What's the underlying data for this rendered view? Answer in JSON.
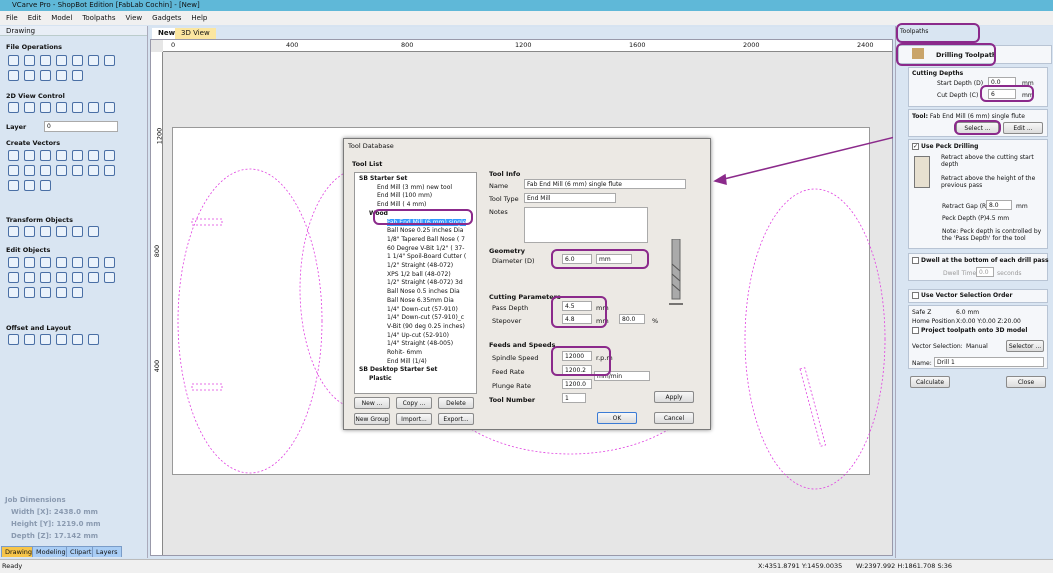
{
  "app": {
    "title": "VCarve Pro - ShopBot Edition [FabLab Cochin] - [New]",
    "menu": [
      "File",
      "Edit",
      "Model",
      "Toolpaths",
      "View",
      "Gadgets",
      "Help"
    ]
  },
  "left_panel": {
    "header": "Drawing",
    "sections": {
      "file_ops": "File Operations",
      "view_control": "2D View Control",
      "layer_label": "Layer",
      "layer_value": "0",
      "create_vectors": "Create Vectors",
      "transform": "Transform Objects",
      "edit_objects": "Edit Objects",
      "offset_layout": "Offset and Layout"
    },
    "job": {
      "title": "Job Dimensions",
      "width": "Width  [X]: 2438.0 mm",
      "height": "Height [Y]: 1219.0 mm",
      "depth": "Depth  [Z]: 17.142 mm"
    },
    "bottom_tabs": [
      "Drawing",
      "Modeling",
      "Clipart",
      "Layers"
    ]
  },
  "view_tabs": [
    "New",
    "3D View"
  ],
  "ruler": {
    "h": [
      "0",
      "400",
      "800",
      "1200",
      "1600",
      "2000",
      "2400"
    ],
    "v": [
      "1200",
      "800",
      "400"
    ]
  },
  "dialog": {
    "title": "Tool Database",
    "tool_list_label": "Tool List",
    "tree": [
      {
        "label": "SB Starter Set",
        "level": 0,
        "group": true
      },
      {
        "label": "End Mill (3 mm) new tool",
        "level": 1
      },
      {
        "label": "End Mill (100 mm)",
        "level": 1
      },
      {
        "label": "End Mill ( 4 mm)",
        "level": 1
      },
      {
        "label": "Wood",
        "level": 1,
        "group": true
      },
      {
        "label": "Fab End Mill (6 mm) single",
        "level": 2,
        "selected": true
      },
      {
        "label": "Ball Nose 0.25 inches Dia",
        "level": 2
      },
      {
        "label": "1/8\" Tapered Ball Nose ( 7",
        "level": 2
      },
      {
        "label": "60 Degree V-Bit 1/2\"  ( 37-",
        "level": 2
      },
      {
        "label": "1 1/4\" Spoil-Board Cutter (",
        "level": 2
      },
      {
        "label": "1/2\" Straight  (48-072)",
        "level": 2
      },
      {
        "label": "XPS 1/2 ball  (48-072)",
        "level": 2
      },
      {
        "label": "1/2\" Straight  (48-072) 3d",
        "level": 2
      },
      {
        "label": "Ball Nose 0.5 inches Dia",
        "level": 2
      },
      {
        "label": "Ball Nose 6.35mm Dia",
        "level": 2
      },
      {
        "label": "1/4\"  Down-cut (57-910)",
        "level": 2
      },
      {
        "label": "1/4\"  Down-cut (57-910)_c",
        "level": 2
      },
      {
        "label": "V-Bit (90 deg 0.25 inches)",
        "level": 2
      },
      {
        "label": "1/4\" Up-cut (52-910)",
        "level": 2
      },
      {
        "label": "1/4\" Straight  (48-005)",
        "level": 2
      },
      {
        "label": "Rohit- 6mm",
        "level": 2
      },
      {
        "label": "End Mill (1/4)",
        "level": 2
      },
      {
        "label": "SB Desktop Starter Set",
        "level": 0,
        "group": true
      },
      {
        "label": "Plastic",
        "level": 1,
        "group": true
      }
    ],
    "buttons": {
      "new": "New ...",
      "copy": "Copy ...",
      "delete": "Delete",
      "new_group": "New Group",
      "import": "Import...",
      "export": "Export...",
      "apply": "Apply",
      "ok": "OK",
      "cancel": "Cancel"
    },
    "tool_info": {
      "label": "Tool Info",
      "name_label": "Name",
      "name": "Fab End Mill (6 mm) single flute",
      "type_label": "Tool Type",
      "type": "End Mill",
      "notes_label": "Notes"
    },
    "geometry": {
      "label": "Geometry",
      "diameter_label": "Diameter (D)",
      "diameter": "6.0",
      "units": "mm"
    },
    "cutting": {
      "label": "Cutting Parameters",
      "pass_label": "Pass Depth",
      "pass": "4.5",
      "stepover_label": "Stepover",
      "stepover": "4.8",
      "unit": "mm",
      "percent": "80.0",
      "pct": "%"
    },
    "feeds": {
      "label": "Feeds and Speeds",
      "spindle_label": "Spindle Speed",
      "spindle": "12000",
      "rpm": "r.p.m",
      "feed_label": "Feed Rate",
      "feed": "1200.2",
      "plunge_label": "Plunge Rate",
      "plunge": "1200.0",
      "rate_units": "mm/min"
    },
    "tool_number_label": "Tool Number",
    "tool_number": "1"
  },
  "right_panel": {
    "header": "Toolpaths",
    "title": "Drilling Toolpath",
    "cutting_depths": {
      "label": "Cutting Depths",
      "start_label": "Start Depth (D)",
      "start": "0.0",
      "cut_label": "Cut Depth (C)",
      "cut": "6",
      "unit": "mm"
    },
    "tool": {
      "label": "Tool:",
      "name": "Fab End Mill (6 mm) single flute",
      "select": "Select ...",
      "edit": "Edit ..."
    },
    "peck": {
      "label": "Use Peck Drilling",
      "checked": true,
      "opt1": "Retract above the cutting start depth",
      "opt2": "Retract above the height of the previous pass",
      "gap_label": "Retract Gap (R)",
      "gap": "8.0",
      "unit": "mm",
      "peck_label": "Peck Depth (P)",
      "peck": "4.5 mm",
      "note": "Note: Peck depth is controlled by the 'Pass Depth' for the tool"
    },
    "dwell": {
      "label": "Dwell at the bottom of each drill pass",
      "time_label": "Dwell Time",
      "time": "0.0",
      "seconds": "seconds"
    },
    "vector_order": "Use Vector Selection Order",
    "safe_z_label": "Safe Z",
    "safe_z": "6.0 mm",
    "home_label": "Home Position",
    "home": "X:0.00 Y:0.00 Z:20.00",
    "project": "Project toolpath onto 3D model",
    "vs_label": "Vector Selection:",
    "vs_value": "Manual",
    "selector": "Selector ...",
    "name_label": "Name:",
    "name": "Drill 1",
    "calculate": "Calculate",
    "close": "Close"
  },
  "status": {
    "text": "Ready",
    "coords": "X:4351.8791 Y:1459.0035",
    "dims": "W:2397.992  H:1861.708  S:36"
  },
  "colors": {
    "highlight": "#8b2a8b",
    "vector": "#e040e0"
  }
}
